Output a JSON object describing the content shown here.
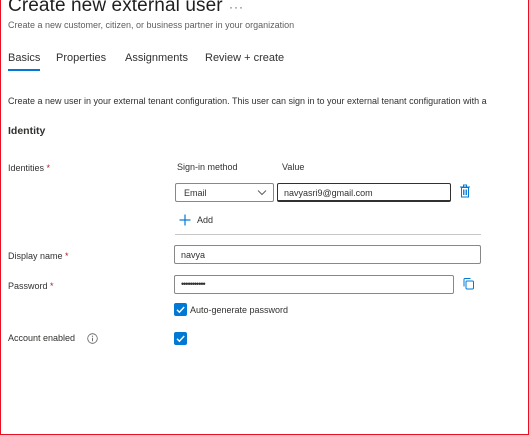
{
  "header": {
    "title": "Create new external user",
    "more_label": "···",
    "subtitle": "Create a new customer, citizen, or business partner in your organization"
  },
  "tabs": [
    {
      "label": "Basics",
      "active": true
    },
    {
      "label": "Properties",
      "active": false
    },
    {
      "label": "Assignments",
      "active": false
    },
    {
      "label": "Review + create",
      "active": false
    }
  ],
  "description": "Create a new user in your external tenant configuration. This user can sign in to your external tenant configuration with a",
  "section_title": "Identity",
  "identities": {
    "label": "Identities",
    "required_mark": "*",
    "col_signin": "Sign-in method",
    "col_value": "Value",
    "signin_method": "Email",
    "value": "navyasri9@gmail.com",
    "add_label": "Add"
  },
  "display_name": {
    "label": "Display name",
    "required_mark": "*",
    "value": "navya"
  },
  "password": {
    "label": "Password",
    "required_mark": "*",
    "value": "•••••••••••",
    "auto_generate_label": "Auto-generate password",
    "auto_generate_checked": true
  },
  "account_enabled": {
    "label": "Account enabled",
    "checked": true
  },
  "colors": {
    "accent": "#0078d4",
    "required": "#a4262c",
    "frame_border": "#e81123"
  }
}
